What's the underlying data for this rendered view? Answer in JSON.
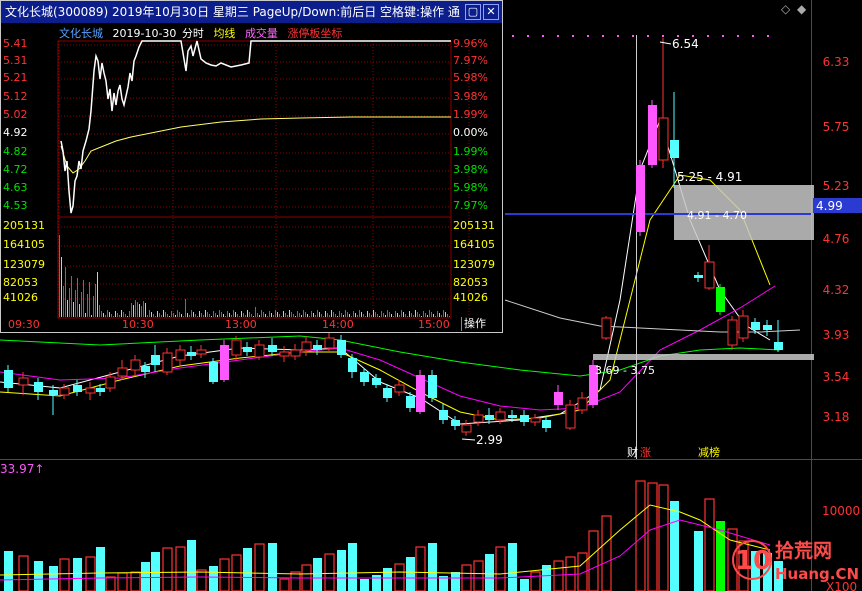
{
  "colors": {
    "up": "#ff3232",
    "down": "#54ffff",
    "limit_up": "#ff57ff",
    "ma5": "#ffffff",
    "ma10": "#ffff00",
    "ma20": "#ff00ff",
    "ma60": "#00ff00",
    "price_line": "#2b3ad0",
    "zone": "#d8d8d8"
  },
  "main": {
    "y_ticks": [
      "6.33",
      "5.75",
      "5.23",
      "4.76",
      "4.32",
      "3.93",
      "3.54",
      "3.18"
    ],
    "current_price": "4.99",
    "annotations": {
      "high": "6.54",
      "low": "2.99",
      "resistance": "5.25 - 4.91",
      "mid": "4.91 - 4.70",
      "support": "3.69 - 3.75"
    },
    "events": {
      "event1": "财",
      "event1b": "涨",
      "event2": "减榜"
    },
    "icons": [
      "diamond-outline-icon",
      "diamond-icon"
    ]
  },
  "volume": {
    "label": "33.97↑",
    "y_tick": "10000",
    "y_tick2": "X100"
  },
  "watermark": {
    "digits": "10",
    "cn": "拾荒网",
    "url": "Huang.CN"
  },
  "popup": {
    "title": "文化长城(300089) 2019年10月30日 星期三 PageUp/Down:前后日 空格键:操作 通...",
    "legend": {
      "name": "文化长城",
      "date": "2019-10-30",
      "type": "分时",
      "avg": "均线",
      "vol": "成交量",
      "axis": "涨停板坐标"
    },
    "price_ticks": [
      "5.41",
      "5.31",
      "5.21",
      "5.12",
      "5.02",
      "4.92",
      "4.82",
      "4.72",
      "4.63",
      "4.53"
    ],
    "pct_ticks": [
      "9.96%",
      "7.97%",
      "5.98%",
      "3.98%",
      "1.99%",
      "0.00%",
      "1.99%",
      "3.98%",
      "5.98%",
      "7.97%"
    ],
    "vol_ticks": [
      "205131",
      "164105",
      "123079",
      "82053",
      "41026"
    ],
    "time_ticks": [
      "09:30",
      "10:30",
      "13:00",
      "14:00",
      "15:00"
    ],
    "op_label": "操作",
    "close_label": "✕",
    "min_label": "▢"
  }
}
